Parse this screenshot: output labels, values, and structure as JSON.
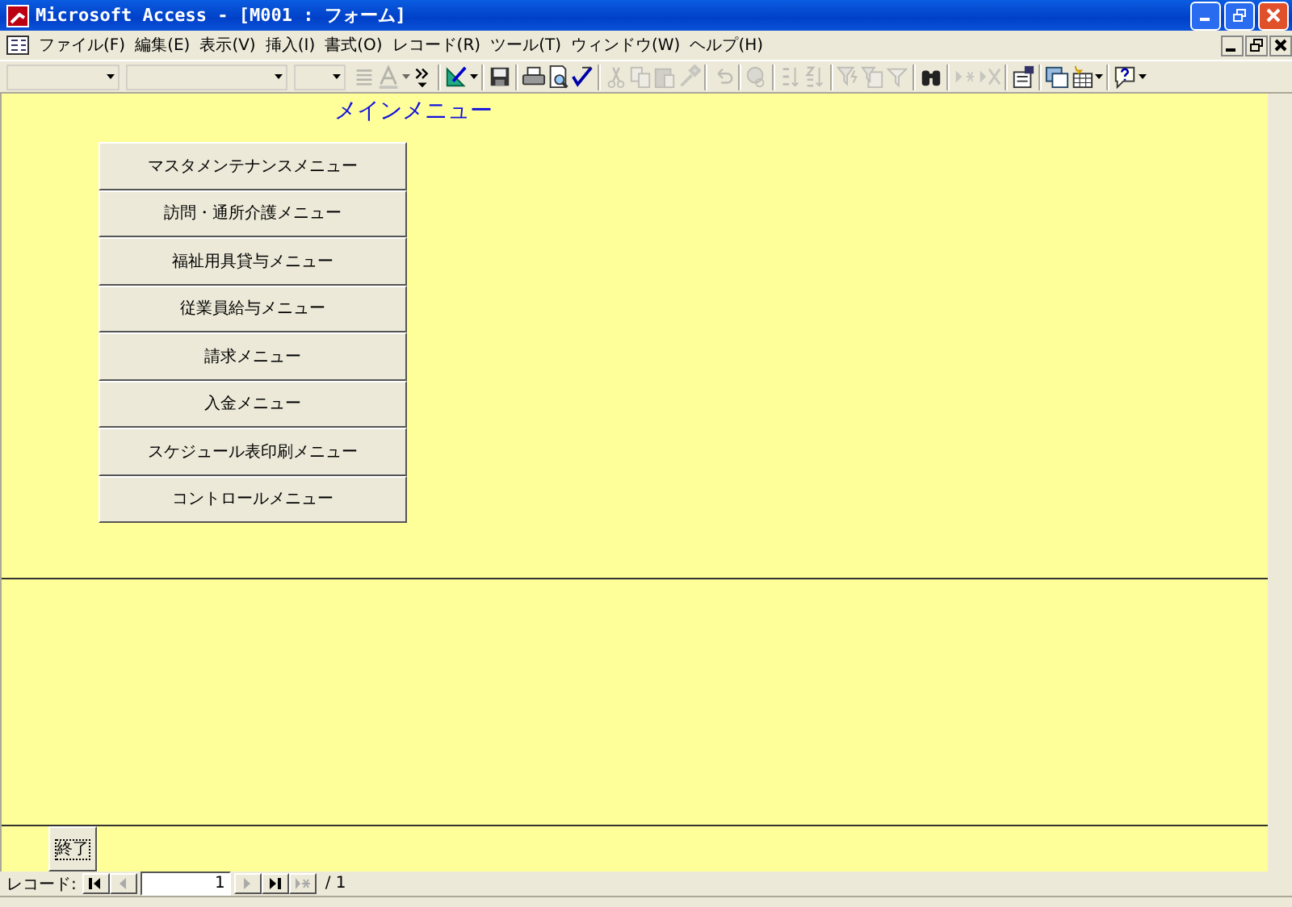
{
  "window": {
    "title": "Microsoft Access - [M001 : フォーム]"
  },
  "menu": [
    {
      "label": "ファイル(F)"
    },
    {
      "label": "編集(E)"
    },
    {
      "label": "表示(V)"
    },
    {
      "label": "挿入(I)"
    },
    {
      "label": "書式(O)"
    },
    {
      "label": "レコード(R)"
    },
    {
      "label": "ツール(T)"
    },
    {
      "label": "ウィンドウ(W)"
    },
    {
      "label": "ヘルプ(H)"
    }
  ],
  "toolbar": {
    "combos": [
      {
        "kind": "object"
      },
      {
        "kind": "font"
      },
      {
        "kind": "size"
      }
    ],
    "buttons": [
      {
        "kind": "align",
        "disabled": true
      },
      {
        "kind": "fontcolor",
        "disabled": true
      },
      {
        "kind": "more",
        "disabled": false
      },
      {
        "kind": "sep"
      },
      {
        "kind": "design",
        "disabled": false
      },
      {
        "kind": "sep"
      },
      {
        "kind": "save",
        "disabled": false
      },
      {
        "kind": "sep"
      },
      {
        "kind": "print",
        "disabled": false
      },
      {
        "kind": "preview",
        "disabled": false
      },
      {
        "kind": "spell",
        "disabled": false
      },
      {
        "kind": "sep"
      },
      {
        "kind": "cut",
        "disabled": true
      },
      {
        "kind": "copy",
        "disabled": true
      },
      {
        "kind": "paste",
        "disabled": true
      },
      {
        "kind": "brush",
        "disabled": true
      },
      {
        "kind": "sep"
      },
      {
        "kind": "undo",
        "disabled": true
      },
      {
        "kind": "sep"
      },
      {
        "kind": "link",
        "disabled": true
      },
      {
        "kind": "sep"
      },
      {
        "kind": "sortasc",
        "disabled": true
      },
      {
        "kind": "sortdesc",
        "disabled": true
      },
      {
        "kind": "sep"
      },
      {
        "kind": "filtersel",
        "disabled": true
      },
      {
        "kind": "filterform",
        "disabled": true
      },
      {
        "kind": "filter",
        "disabled": true
      },
      {
        "kind": "sep"
      },
      {
        "kind": "find",
        "disabled": false
      },
      {
        "kind": "sep"
      },
      {
        "kind": "newrec",
        "disabled": true
      },
      {
        "kind": "delrec",
        "disabled": true
      },
      {
        "kind": "sep"
      },
      {
        "kind": "props",
        "disabled": false
      },
      {
        "kind": "sep"
      },
      {
        "kind": "dbwin",
        "disabled": false
      },
      {
        "kind": "newobj",
        "disabled": false
      },
      {
        "kind": "sep"
      },
      {
        "kind": "help",
        "disabled": false
      }
    ]
  },
  "form": {
    "title": "メインメニュー",
    "buttons": [
      {
        "label": "マスタメンテナンスメニュー"
      },
      {
        "label": "訪問・通所介護メニュー"
      },
      {
        "label": "福祉用具貸与メニュー"
      },
      {
        "label": "従業員給与メニュー"
      },
      {
        "label": "請求メニュー"
      },
      {
        "label": "入金メニュー"
      },
      {
        "label": "スケジュール表印刷メニュー"
      },
      {
        "label": "コントロールメニュー"
      }
    ],
    "exit_button": {
      "label": "終了"
    }
  },
  "record_nav": {
    "label": "レコード:",
    "current": "1",
    "total": "/ 1",
    "buttons": [
      {
        "kind": "first",
        "disabled": false
      },
      {
        "kind": "prev",
        "disabled": true
      },
      {
        "kind": "field"
      },
      {
        "kind": "next",
        "disabled": true
      },
      {
        "kind": "last",
        "disabled": false
      },
      {
        "kind": "new",
        "disabled": true
      }
    ]
  }
}
